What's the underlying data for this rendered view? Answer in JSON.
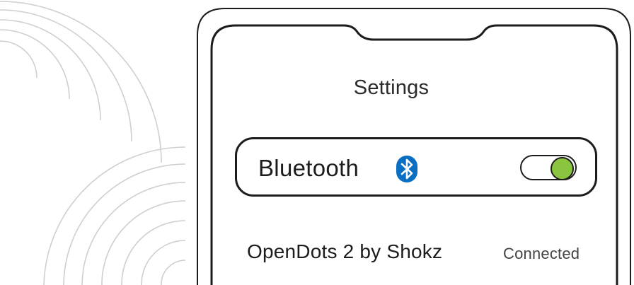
{
  "screen": {
    "title": "Settings"
  },
  "bluetooth": {
    "label": "Bluetooth",
    "icon": "bluetooth-icon",
    "enabled": true,
    "toggle_on_color": "#8bc53f"
  },
  "devices": [
    {
      "name": "OpenDots 2 by Shokz",
      "status": "Connected"
    }
  ],
  "colors": {
    "bluetooth_brand": "#0a6fc2",
    "outline": "#1c1c1c",
    "wave_lines": "#cfcfcf"
  }
}
